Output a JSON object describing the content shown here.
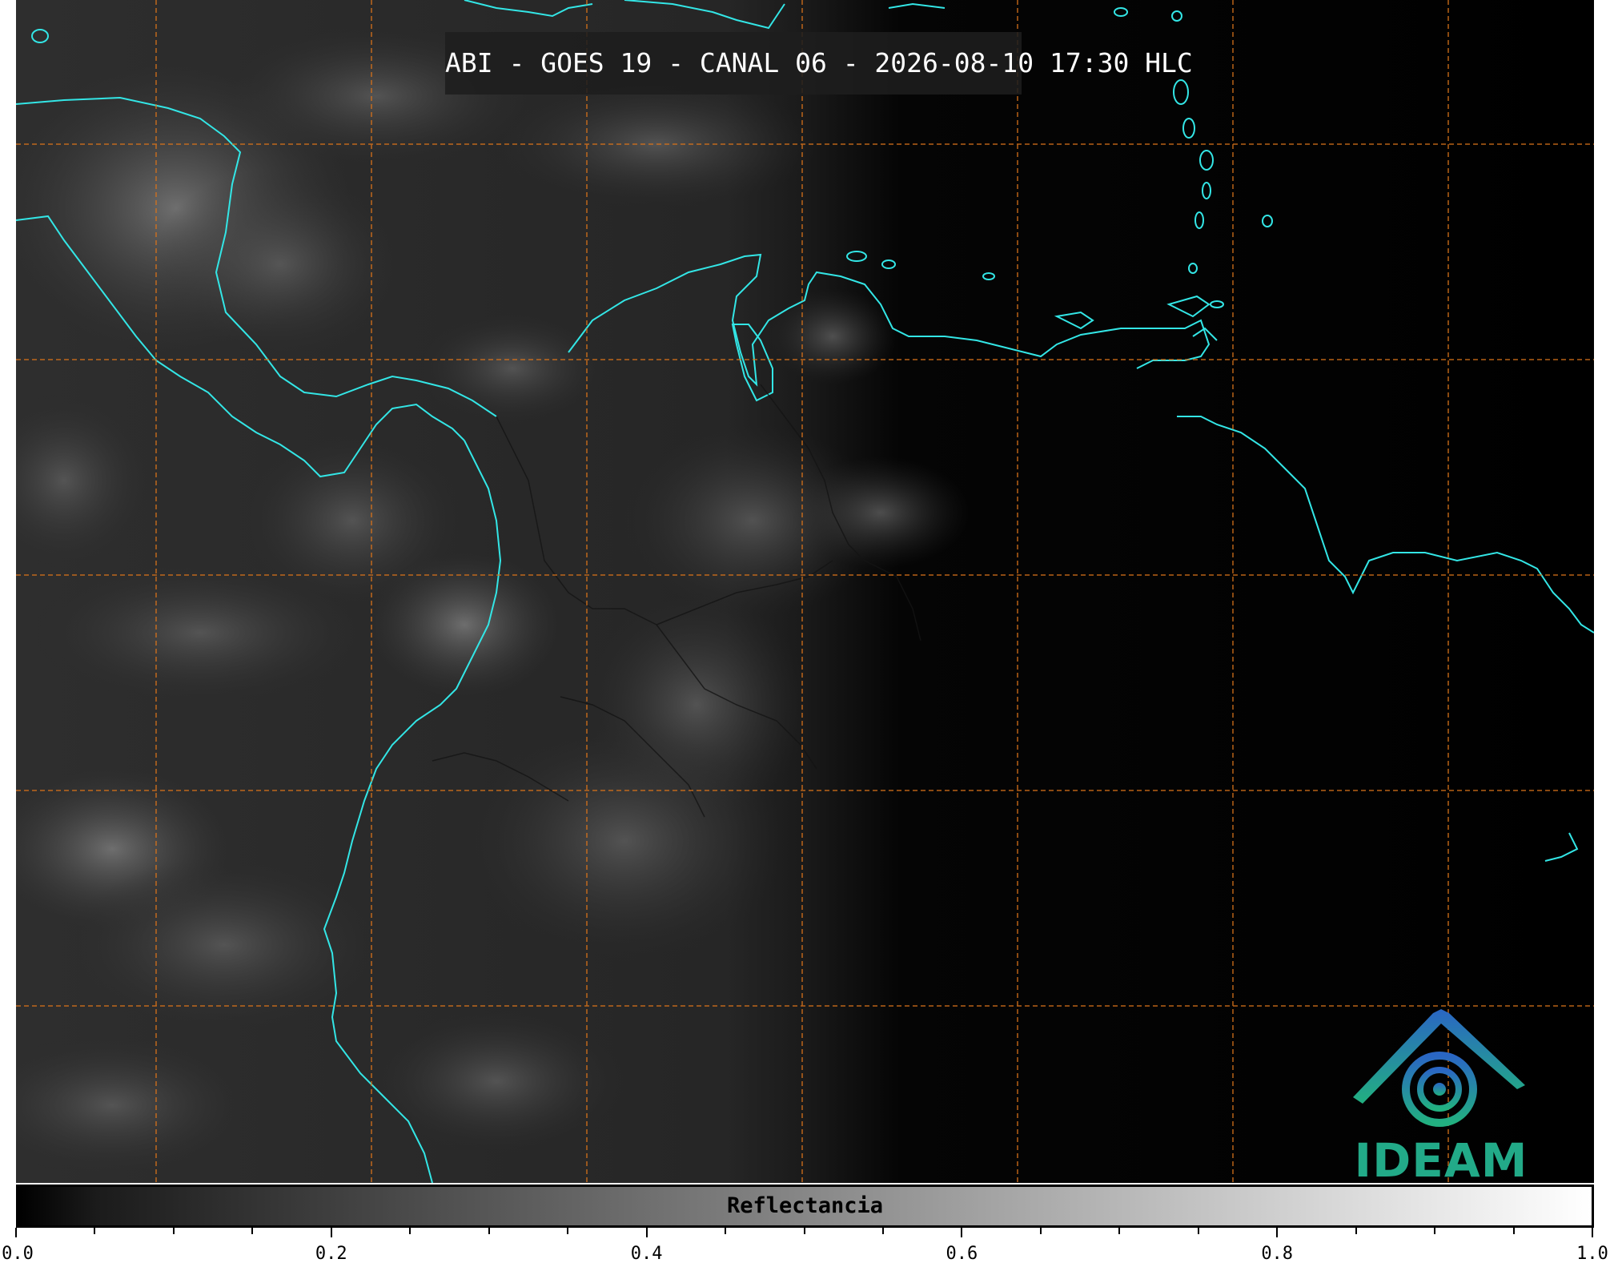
{
  "map": {
    "title": "ABI - GOES 19 - CANAL 06 - 2026-08-10 17:30 HLC",
    "coastline_color": "#33e6e6",
    "gridline_color": "#d9731a",
    "logo": {
      "icon": "ideam-logo-icon",
      "text": "IDEAM",
      "color": "#22aa88"
    }
  },
  "colorbar": {
    "label": "Reflectancia",
    "range": [
      0.0,
      1.0
    ],
    "ticks": [
      "0.0",
      "0.2",
      "0.4",
      "0.6",
      "0.8",
      "1.0"
    ]
  }
}
